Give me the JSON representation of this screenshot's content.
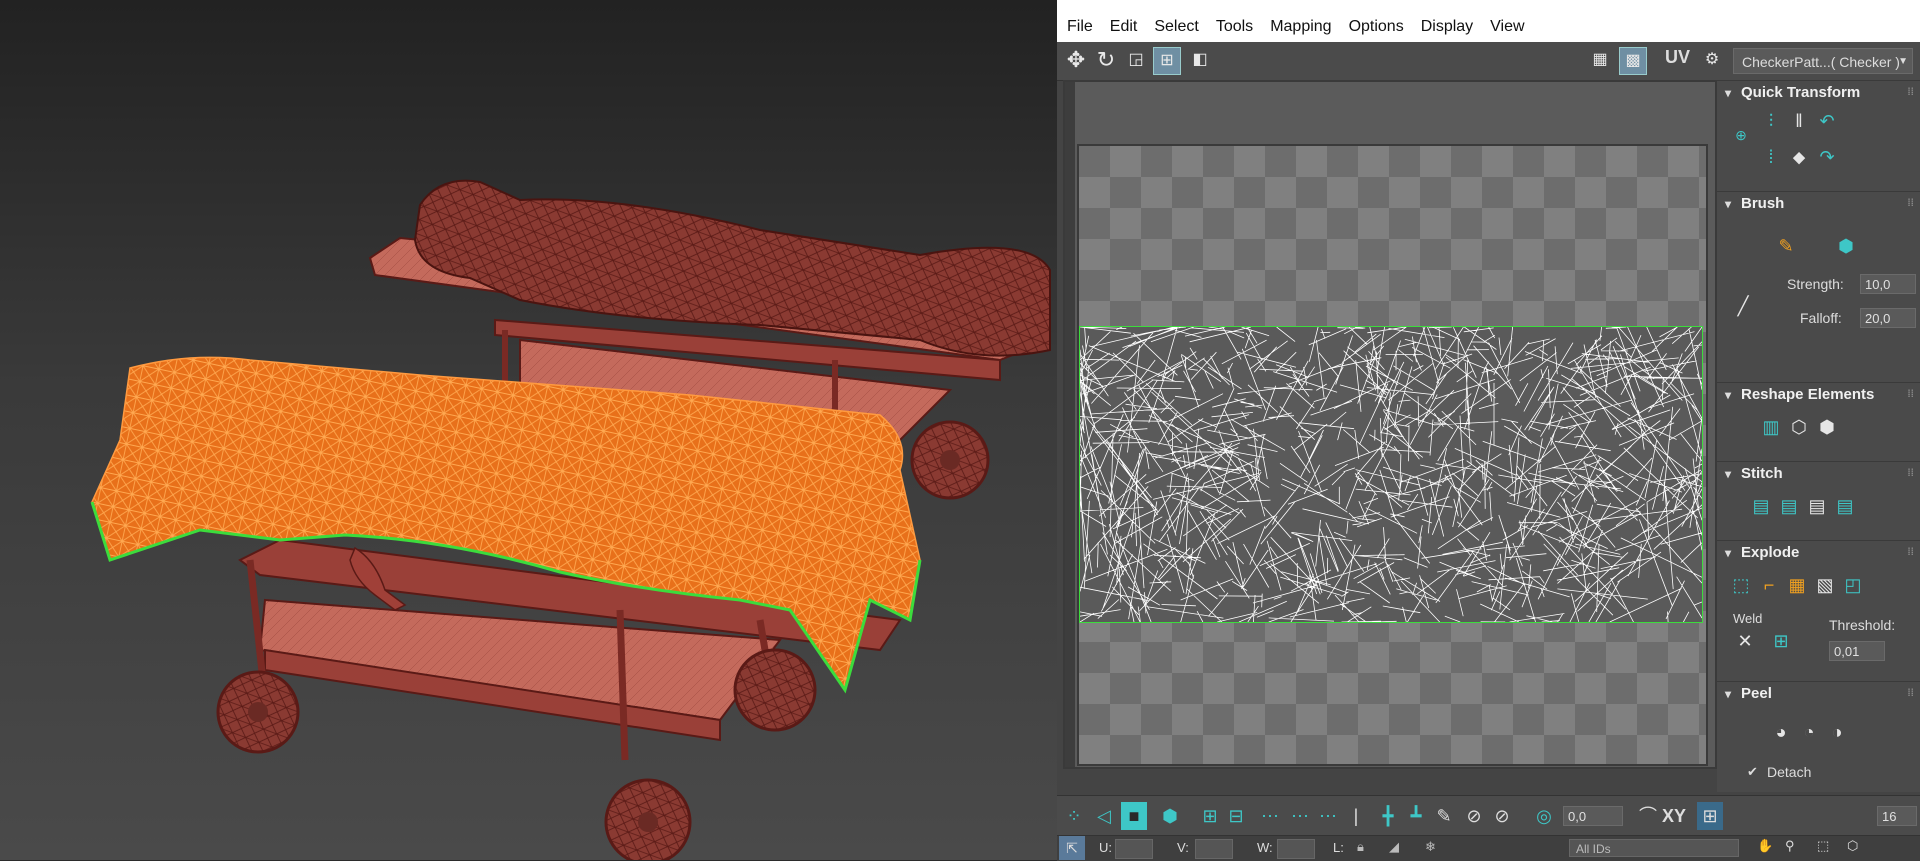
{
  "menu": [
    "File",
    "Edit",
    "Select",
    "Tools",
    "Mapping",
    "Options",
    "Display",
    "View"
  ],
  "toolbar": {
    "uv_label": "UV",
    "texture_select": "CheckerPatt...( Checker )"
  },
  "rollouts": {
    "quick_transform": "Quick Transform",
    "brush": "Brush",
    "strength_label": "Strength:",
    "strength_value": "10,0",
    "falloff_label": "Falloff:",
    "falloff_value": "20,0",
    "reshape": "Reshape Elements",
    "stitch": "Stitch",
    "explode": "Explode",
    "weld": "Weld",
    "threshold_label": "Threshold:",
    "threshold_value": "0,01",
    "peel": "Peel",
    "detach": "Detach"
  },
  "bottom": {
    "angle_value": "0,0",
    "axis_label": "XY",
    "grid_value": "16",
    "u_label": "U:",
    "v_label": "V:",
    "w_label": "W:",
    "l_label": "L:",
    "ids_select": "All IDs"
  },
  "colors": {
    "selection": "#f07a10",
    "edge": "#3cdc3c",
    "stretcher": "#a04038",
    "accent": "#3ec7c7"
  }
}
